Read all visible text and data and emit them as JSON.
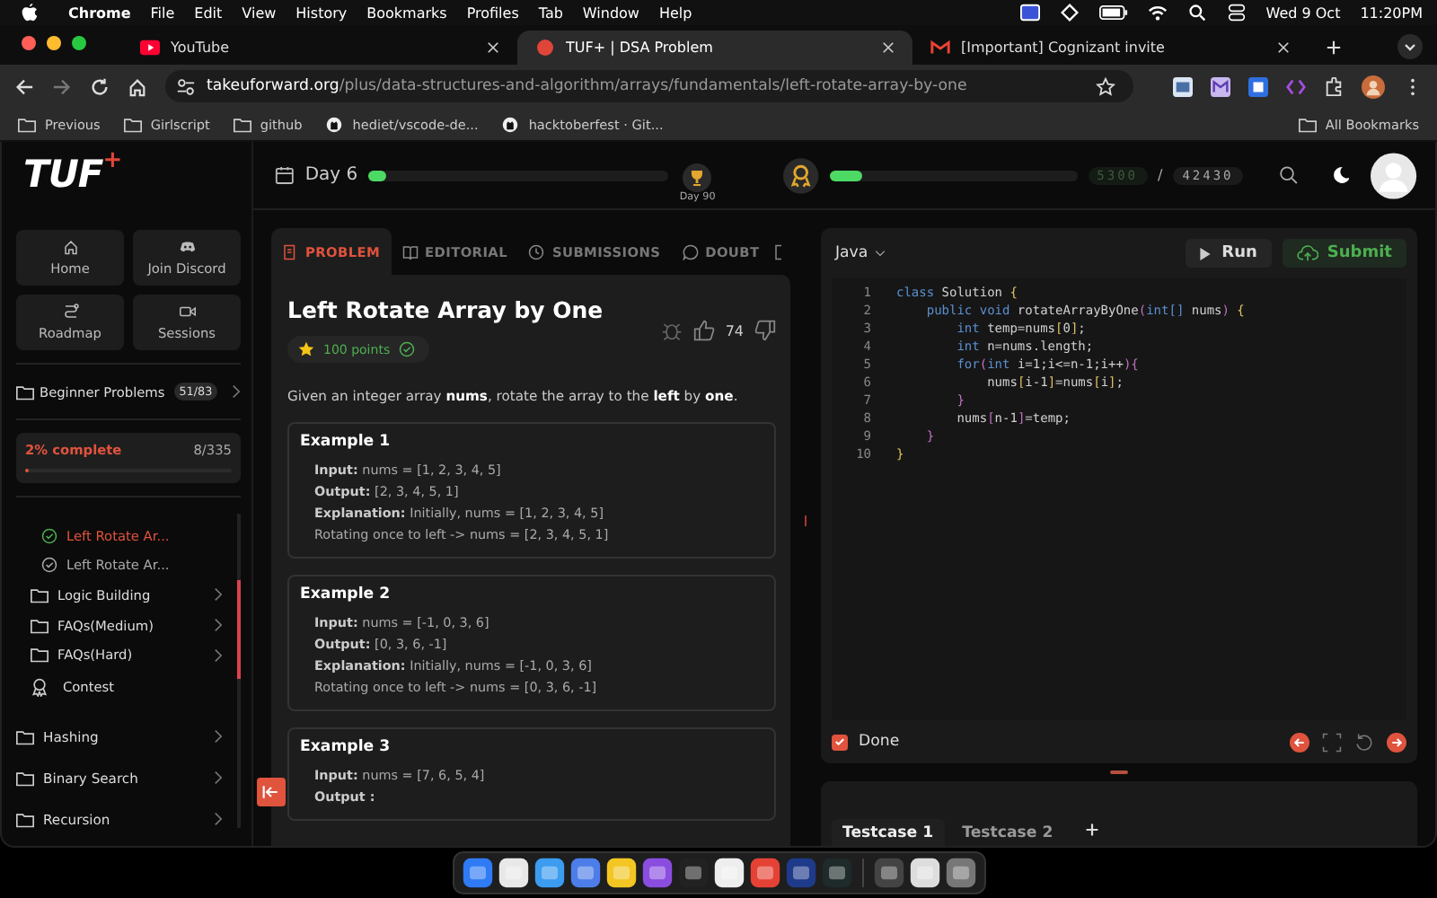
{
  "menu_bar": {
    "items": [
      "Chrome",
      "File",
      "Edit",
      "View",
      "History",
      "Bookmarks",
      "Profiles",
      "Tab",
      "Window",
      "Help"
    ],
    "date": "Wed 9 Oct",
    "time": "11:20PM"
  },
  "browser": {
    "tabs": [
      {
        "title": "YouTube",
        "kind": "youtube",
        "selected": false
      },
      {
        "title": "TUF+ | DSA Problem",
        "kind": "tuf",
        "selected": true
      },
      {
        "title": "[Important] Cognizant invite",
        "kind": "gmail",
        "selected": false
      }
    ],
    "url": {
      "host": "takeuforward.org",
      "path": "/plus/data-structures-and-algorithm/arrays/fundamentals/left-rotate-array-by-one"
    },
    "bookmarks": [
      {
        "label": "Previous",
        "kind": "folder"
      },
      {
        "label": "Girlscript",
        "kind": "folder"
      },
      {
        "label": "github",
        "kind": "folder"
      },
      {
        "label": "hediet/vscode-de...",
        "kind": "github"
      },
      {
        "label": "hacktoberfest · Git...",
        "kind": "github"
      }
    ],
    "all_bookmarks": "All Bookmarks"
  },
  "sidebar": {
    "logo": {
      "text": "TUF",
      "mark": "+"
    },
    "nav_buttons": [
      {
        "label": "Home",
        "kind": "home"
      },
      {
        "label": "Join Discord",
        "kind": "discord"
      },
      {
        "label": "Roadmap",
        "kind": "roadmap"
      },
      {
        "label": "Sessions",
        "kind": "video"
      }
    ],
    "course": {
      "label": "Beginner Problems",
      "count": "51/83"
    },
    "progress": {
      "label": "2% complete",
      "count": "8/335",
      "level": 0.02
    },
    "nested_items": [
      {
        "label": "Left Rotate Ar...",
        "kind": "problem",
        "solved": true,
        "selected": true
      },
      {
        "label": "Left Rotate Ar...",
        "kind": "problem",
        "solved": false,
        "selected": false
      },
      {
        "label": "Logic Building",
        "kind": "folder"
      },
      {
        "label": "FAQs(Medium)",
        "kind": "folder"
      },
      {
        "label": "FAQs(Hard)",
        "kind": "folder"
      },
      {
        "label": "Contest",
        "kind": "contest"
      }
    ],
    "folders": [
      {
        "label": "Hashing"
      },
      {
        "label": "Binary Search"
      },
      {
        "label": "Recursion"
      }
    ]
  },
  "header": {
    "streak": {
      "label": "Day 6",
      "level": 0.03,
      "goal": "Day 90"
    },
    "xp": {
      "level": 0.13,
      "current": "5300",
      "separator": "/",
      "total": "42430"
    }
  },
  "problem_tabs": [
    {
      "label": "PROBLEM",
      "kind": "problem",
      "selected": true
    },
    {
      "label": "EDITORIAL",
      "kind": "editorial",
      "selected": false
    },
    {
      "label": "SUBMISSIONS",
      "kind": "submissions",
      "selected": false
    },
    {
      "label": "DOUBT",
      "kind": "doubt",
      "selected": false
    }
  ],
  "problem": {
    "title": "Left Rotate Array by One",
    "points": "100 points",
    "solved": true,
    "likes": "74",
    "description": "Given an integer array **nums**, rotate the array to the **left** by **one**.",
    "examples": [
      {
        "title": "Example 1",
        "lines": [
          "**Input:** nums = [1, 2, 3, 4, 5]",
          "**Output:** [2, 3, 4, 5, 1]",
          "**Explanation:** Initially, nums = [1, 2, 3, 4, 5]",
          "Rotating once to left -> nums = [2, 3, 4, 5, 1]"
        ]
      },
      {
        "title": "Example 2",
        "lines": [
          "**Input:** nums = [-1, 0, 3, 6]",
          "**Output:** [0, 3, 6, -1]",
          "**Explanation:** Initially, nums = [-1, 0, 3, 6]",
          "Rotating once to left -> nums = [0, 3, 6, -1]"
        ]
      },
      {
        "title": "Example 3",
        "lines": [
          "**Input:** nums = [7, 6, 5, 4]",
          "**Output :**"
        ]
      }
    ]
  },
  "editor": {
    "language": "Java",
    "run": "Run",
    "submit": "Submit",
    "code": [
      {
        "number": "1",
        "tokens": [
          {
            "text": "class",
            "kind": "keyword"
          },
          {
            "text": " Solution ",
            "kind": "plain"
          },
          {
            "text": "{",
            "kind": "brace"
          }
        ]
      },
      {
        "number": "2",
        "tokens": [
          {
            "text": "    public void",
            "kind": "keyword"
          },
          {
            "text": " rotateArrayByOne",
            "kind": "plain"
          },
          {
            "text": "(",
            "kind": "bracket"
          },
          {
            "text": "int[]",
            "kind": "keyword"
          },
          {
            "text": " nums",
            "kind": "plain"
          },
          {
            "text": ")",
            "kind": "bracket"
          },
          {
            "text": " {",
            "kind": "brace"
          }
        ]
      },
      {
        "number": "3",
        "tokens": [
          {
            "text": "        int",
            "kind": "keyword"
          },
          {
            "text": " temp=nums",
            "kind": "plain"
          },
          {
            "text": "[",
            "kind": "brace"
          },
          {
            "text": "0",
            "kind": "plain"
          },
          {
            "text": "]",
            "kind": "brace"
          },
          {
            "text": ";",
            "kind": "plain"
          }
        ]
      },
      {
        "number": "4",
        "tokens": [
          {
            "text": "        int",
            "kind": "keyword"
          },
          {
            "text": " n=nums.length;",
            "kind": "plain"
          }
        ]
      },
      {
        "number": "5",
        "tokens": [
          {
            "text": "        for",
            "kind": "keyword"
          },
          {
            "text": "(",
            "kind": "bracket"
          },
          {
            "text": "int",
            "kind": "keyword"
          },
          {
            "text": " i=1;i<=n-1;i++",
            "kind": "plain"
          },
          {
            "text": "){",
            "kind": "bracket"
          }
        ]
      },
      {
        "number": "6",
        "tokens": [
          {
            "text": "            nums",
            "kind": "plain"
          },
          {
            "text": "[",
            "kind": "brace"
          },
          {
            "text": "i-1",
            "kind": "plain"
          },
          {
            "text": "]",
            "kind": "brace"
          },
          {
            "text": "=nums",
            "kind": "plain"
          },
          {
            "text": "[",
            "kind": "brace"
          },
          {
            "text": "i",
            "kind": "plain"
          },
          {
            "text": "]",
            "kind": "brace"
          },
          {
            "text": ";",
            "kind": "plain"
          }
        ]
      },
      {
        "number": "7",
        "tokens": [
          {
            "text": "        }",
            "kind": "bracket"
          }
        ]
      },
      {
        "number": "8",
        "tokens": [
          {
            "text": "        nums",
            "kind": "plain"
          },
          {
            "text": "[",
            "kind": "bracket"
          },
          {
            "text": "n-1",
            "kind": "plain"
          },
          {
            "text": "]",
            "kind": "bracket"
          },
          {
            "text": "=temp;",
            "kind": "plain"
          }
        ]
      },
      {
        "number": "9",
        "tokens": [
          {
            "text": "    }",
            "kind": "bracket"
          }
        ]
      },
      {
        "number": "10",
        "tokens": [
          {
            "text": "}",
            "kind": "brace"
          }
        ]
      }
    ],
    "done": {
      "label": "Done",
      "checked": true
    }
  },
  "testcases": [
    {
      "label": "Testcase 1",
      "selected": true
    },
    {
      "label": "Testcase 2",
      "selected": false
    }
  ]
}
